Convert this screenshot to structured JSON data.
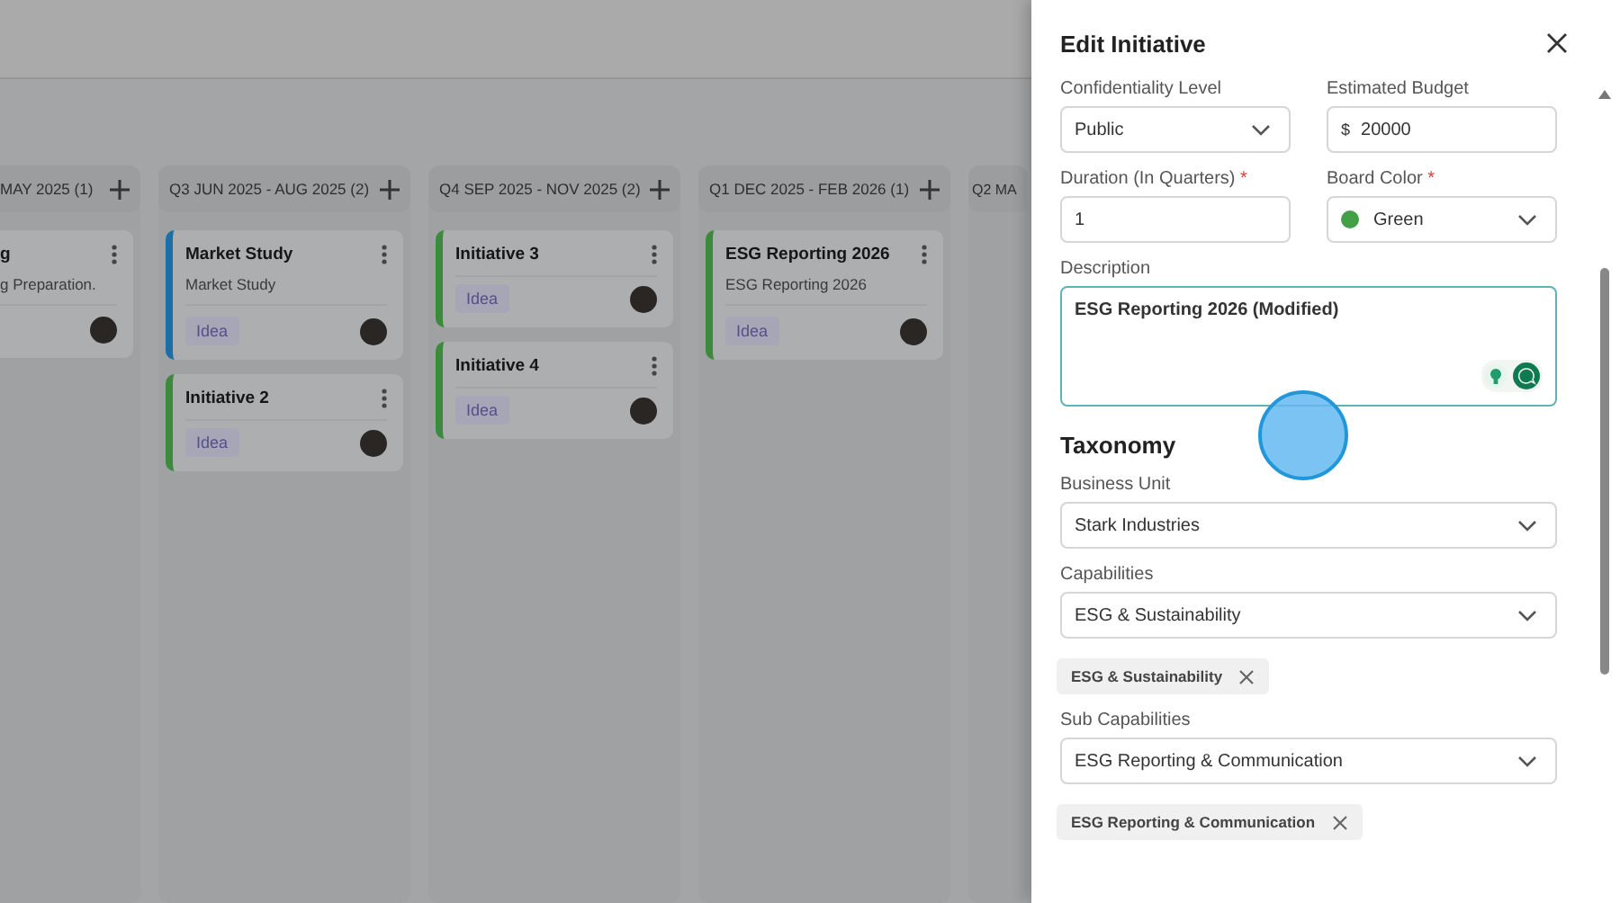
{
  "board": {
    "columns": [
      {
        "title": "MAY 2025 (1)",
        "cards": [
          {
            "title": "g",
            "description": "g Preparation."
          }
        ]
      },
      {
        "title": "Q3 JUN 2025 - AUG 2025 (2)",
        "cards": [
          {
            "title": "Market Study",
            "description": "Market Study",
            "tag": "Idea",
            "color": "#1a6fa8"
          },
          {
            "title": "Initiative 2",
            "tag": "Idea",
            "color": "#3c8a3c"
          }
        ]
      },
      {
        "title": "Q4 SEP 2025 - NOV 2025 (2)",
        "cards": [
          {
            "title": "Initiative 3",
            "tag": "Idea",
            "color": "#3c8a3c"
          },
          {
            "title": "Initiative 4",
            "tag": "Idea",
            "color": "#3c8a3c"
          }
        ]
      },
      {
        "title": "Q1 DEC 2025 - FEB 2026 (1)",
        "cards": [
          {
            "title": "ESG Reporting 2026",
            "description": "ESG Reporting 2026",
            "tag": "Idea",
            "color": "#3c8a3c"
          }
        ]
      },
      {
        "title": "Q2 MA"
      }
    ]
  },
  "drawer": {
    "title": "Edit Initiative",
    "rows": [
      [
        {
          "kind": "select",
          "label": "Confidentiality Level",
          "value": "Public"
        },
        {
          "kind": "currency",
          "label": "Estimated Budget",
          "prefix": "$",
          "value": "20000"
        }
      ],
      [
        {
          "kind": "text",
          "label": "Duration (In Quarters)",
          "required_mark": "*",
          "value": "1"
        },
        {
          "kind": "color-select",
          "label": "Board Color",
          "required_mark": "*",
          "value": "Green",
          "color": "#43a047"
        }
      ],
      [
        {
          "kind": "textarea",
          "label": "Description",
          "value": "ESG Reporting 2026 (Modified)"
        }
      ]
    ],
    "section": "Taxonomy",
    "taxonomy": [
      {
        "kind": "select",
        "label": "Business Unit",
        "value": "Stark Industries"
      },
      {
        "kind": "select",
        "label": "Capabilities",
        "value": "ESG & Sustainability",
        "chips": [
          "ESG & Sustainability"
        ]
      },
      {
        "kind": "select",
        "label": "Sub Capabilities",
        "value": "ESG Reporting & Communication",
        "chips": [
          "ESG Reporting & Communication"
        ]
      }
    ]
  }
}
